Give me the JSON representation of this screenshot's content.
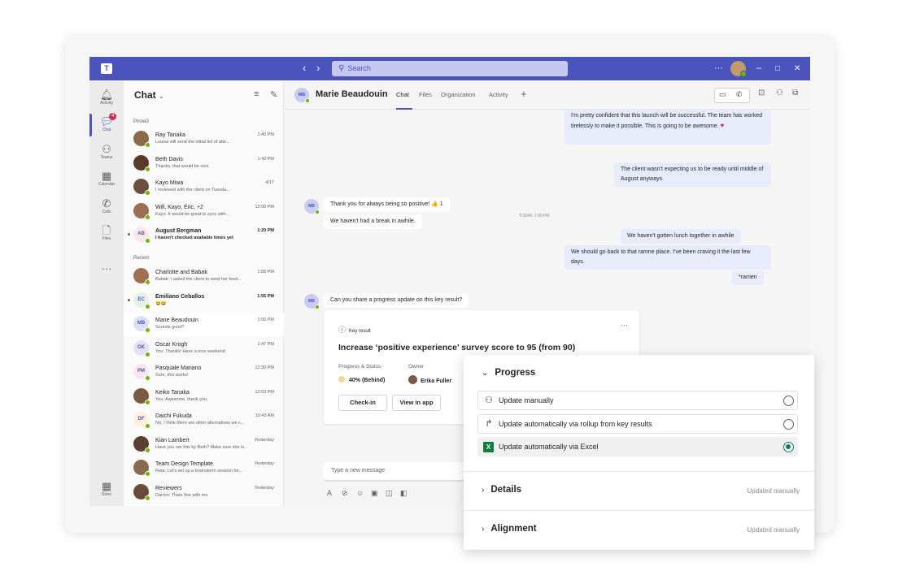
{
  "titlebar": {
    "search_placeholder": "Search",
    "nav_back": "‹",
    "nav_forward": "›",
    "more": "···",
    "minimize": "–",
    "maximize": "□",
    "close": "✕",
    "accent": "#4b53bc"
  },
  "rail": {
    "items": [
      {
        "label": "Activity",
        "icon": "bell-icon",
        "glyph": "🔔︎"
      },
      {
        "label": "Chat",
        "icon": "chat-icon",
        "glyph": "💬︎",
        "badge": "4"
      },
      {
        "label": "Teams",
        "icon": "teams-icon",
        "glyph": "⚇"
      },
      {
        "label": "Calendar",
        "icon": "calendar-icon",
        "glyph": "▦"
      },
      {
        "label": "Calls",
        "icon": "phone-icon",
        "glyph": "✆"
      },
      {
        "label": "Files",
        "icon": "file-icon",
        "glyph": "🗋"
      },
      {
        "label": "",
        "icon": "more-icon",
        "glyph": "···"
      },
      {
        "label": "Store",
        "icon": "store-icon",
        "glyph": "▦"
      }
    ]
  },
  "chatlist": {
    "title": "Chat",
    "pinned_label": "Pinned",
    "recent_label": "Recent",
    "pinned": [
      {
        "name": "Ray Tanaka",
        "time": "1:40 PM",
        "preview": "Louisa will send the initial list of atte...",
        "initials": "",
        "av_color": "#8a6a4a"
      },
      {
        "name": "Beth Davis",
        "time": "1:43 PM",
        "preview": "Thanks, that would be nice.",
        "initials": "",
        "av_color": "#5a3a2a"
      },
      {
        "name": "Kayo Miwa",
        "time": "4/17",
        "preview": "I reviewed with the client on Tuesda...",
        "initials": "",
        "av_color": "#6a5040"
      },
      {
        "name": "Will, Kayo, Eric, +2",
        "time": "12:00 PM",
        "preview": "Kayo: It would be great to sync with...",
        "initials": "",
        "av_color": "#9a7050"
      },
      {
        "name": "August Bergman",
        "time": "1:20 PM",
        "preview": "I haven't checked available times yet",
        "initials": "AB",
        "av_color": "#fde7e9",
        "unread": true
      }
    ],
    "recent": [
      {
        "name": "Charlotte and Babak",
        "time": "1:58 PM",
        "preview": "Babak: I asked the client to send her feed...",
        "initials": "",
        "av_color": "#a07050"
      },
      {
        "name": "Emiliano Ceballos",
        "time": "1:55 PM",
        "preview": "😄😄",
        "initials": "EC",
        "av_color": "#e6f2e6",
        "unread": true
      },
      {
        "name": "Marie Beaudouin",
        "time": "1:00 PM",
        "preview": "Sounds good?",
        "initials": "MB",
        "av_color": "#dde0f7",
        "selected": true
      },
      {
        "name": "Oscar Krogh",
        "time": "1:47 PM",
        "preview": "You: Thanks! Have a nice weekend",
        "initials": "OK",
        "av_color": "#e8e0f5"
      },
      {
        "name": "Pasquale Mariano",
        "time": "12:30 PM",
        "preview": "Sure, this works!",
        "initials": "PM",
        "av_color": "#fde7ef"
      },
      {
        "name": "Keiko Tanaka",
        "time": "12:03 PM",
        "preview": "You: Awesome, thank you.",
        "initials": "",
        "av_color": "#7a5a40"
      },
      {
        "name": "Daichi Fukuda",
        "time": "10:43 AM",
        "preview": "No, I think there are other alternatives we c...",
        "initials": "DF",
        "av_color": "#fdf0dd"
      },
      {
        "name": "Kian Lambert",
        "time": "Yesterday",
        "preview": "Have you ran this by Beth? Make sure she is...",
        "initials": "",
        "av_color": "#5a4030"
      },
      {
        "name": "Team Design Template",
        "time": "Yesterday",
        "preview": "Reta: Let's set up a brainstorm session for...",
        "initials": "",
        "av_color": "#8a6a50"
      },
      {
        "name": "Reviewers",
        "time": "Yesterday",
        "preview": "Darren: Thats fine with me",
        "initials": "",
        "av_color": "#6a4a3a"
      }
    ]
  },
  "header": {
    "avatar": "MB",
    "name": "Marie Beaudouin",
    "tabs": [
      "Chat",
      "Files",
      "Organization",
      "Activity"
    ],
    "add_tab": "+"
  },
  "messages": {
    "m1": "I'm pretty confident that this launch will be successful. The team has worked tirelessly to make it possible. This is going to be awesome.",
    "m2": "The client wasn't expecting us to be ready until middle of August anyways",
    "m3": "Thank you for always being so positive!",
    "m3_reaction": "👍 1",
    "m4": "We haven't had a break in awhile.",
    "timestamp": "TODAY, 2:00 PM",
    "m5": "We haven't gotten lunch together in awhile",
    "m6": "We should go back to that ramne place. I've been craving it the last few days.",
    "m7": "*ramen",
    "m8": "Can you share a progress update on this key result?",
    "avatar": "MB"
  },
  "key_result": {
    "label": "Key result",
    "more": "···",
    "title": "Increase ‘positive experience’ survey score to 95 (from 90)",
    "status_label": "Progress & Status",
    "owner_label": "Owner",
    "status_value": "40% (Behind)",
    "progress_fraction": 0.4,
    "owner": "Erika Fuller",
    "checkin": "Check-in",
    "view": "View in app"
  },
  "compose": {
    "placeholder": "Type a new message"
  },
  "panel": {
    "progress_title": "Progress",
    "options": [
      {
        "label": "Update manually",
        "icon": "person-icon",
        "selected": false
      },
      {
        "label": "Update automatically via rollup from key results",
        "icon": "share-arrow-icon",
        "selected": false
      },
      {
        "label": "Update automatically via Excel",
        "icon": "excel-icon",
        "selected": true
      }
    ],
    "details_title": "Details",
    "details_meta": "Updated manually",
    "alignment_title": "Alignment",
    "alignment_meta": "Updated manually"
  }
}
